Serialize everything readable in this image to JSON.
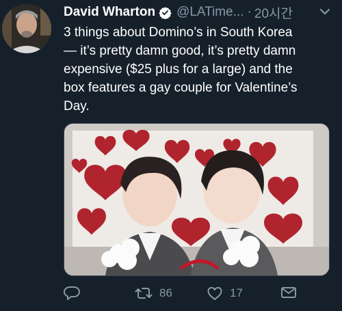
{
  "tweet": {
    "author_name": "David Wharton",
    "handle": "@LATime...",
    "separator": "·",
    "time": "20시간",
    "text_lines": [
      "3 things about Domino’s in South Korea",
      "— it’s pretty damn good, it’s pretty damn",
      "expensive ($25 plus for a large) and the",
      "box features a gay couple for Valentine’s",
      "Day."
    ],
    "retweet_count": "86",
    "like_count": "17"
  },
  "icons": {
    "verified": "verified-badge-icon",
    "menu": "chevron-down-icon",
    "reply": "reply-icon",
    "retweet": "retweet-icon",
    "like": "heart-icon",
    "message": "envelope-icon"
  },
  "colors": {
    "background": "#15202b",
    "text": "#ffffff",
    "muted": "#8899a6",
    "verified": "#ffffff"
  }
}
